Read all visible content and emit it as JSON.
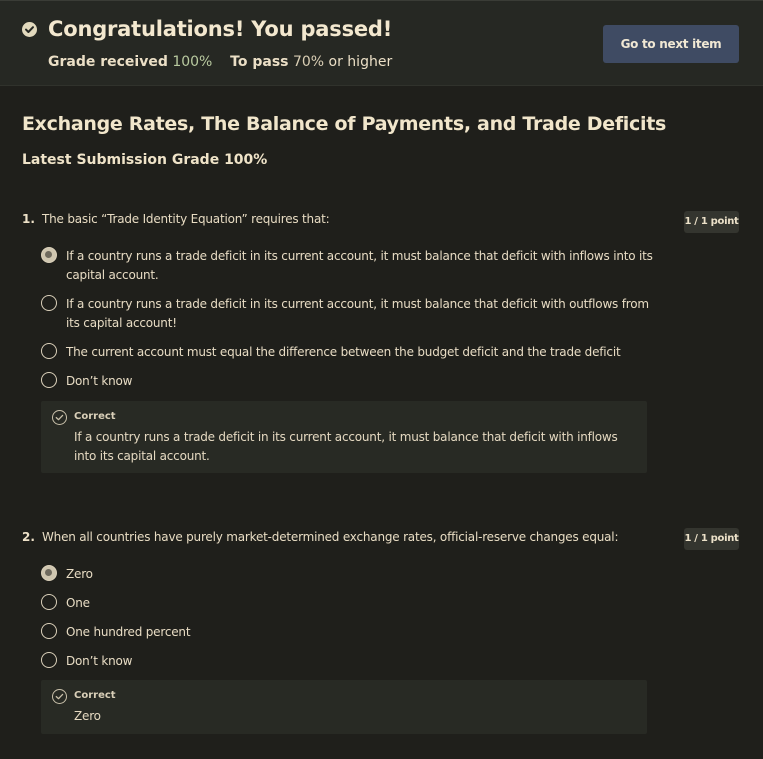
{
  "banner": {
    "heading": "Congratulations! You passed!",
    "grade_received_label": "Grade received",
    "grade_received_value": "100%",
    "to_pass_label": "To pass",
    "to_pass_value": "70%",
    "to_pass_suffix": "or higher",
    "next_button": "Go to next item"
  },
  "quiz": {
    "title": "Exchange Rates, The Balance of Payments, and Trade Deficits",
    "submission_grade": "Latest Submission Grade 100%"
  },
  "questions": [
    {
      "number": "1.",
      "text": "The basic “Trade Identity Equation” requires that:",
      "points": "1 / 1 point",
      "options": [
        {
          "label": "If a country runs a trade deficit in its current account, it must balance that deficit with inflows into its capital account.",
          "selected": true
        },
        {
          "label": "If a country runs a trade deficit in its current account, it must balance that deficit with outflows from its capital account!",
          "selected": false
        },
        {
          "label": "The current account must equal the difference between the budget deficit and the trade deficit",
          "selected": false
        },
        {
          "label": "Don’t know",
          "selected": false
        }
      ],
      "feedback_title": "Correct",
      "feedback_text": "If a country runs a trade deficit in its current account, it must balance that deficit with inflows into its capital account."
    },
    {
      "number": "2.",
      "text": "When all countries have purely market-determined exchange rates, official-reserve changes equal:",
      "points": "1 / 1 point",
      "options": [
        {
          "label": "Zero",
          "selected": true
        },
        {
          "label": "One",
          "selected": false
        },
        {
          "label": "One hundred percent",
          "selected": false
        },
        {
          "label": "Don’t know",
          "selected": false
        }
      ],
      "feedback_title": "Correct",
      "feedback_text": "Zero"
    }
  ],
  "icons": {
    "passed": "check-circle-icon",
    "feedback": "check-circle-outline-icon"
  }
}
